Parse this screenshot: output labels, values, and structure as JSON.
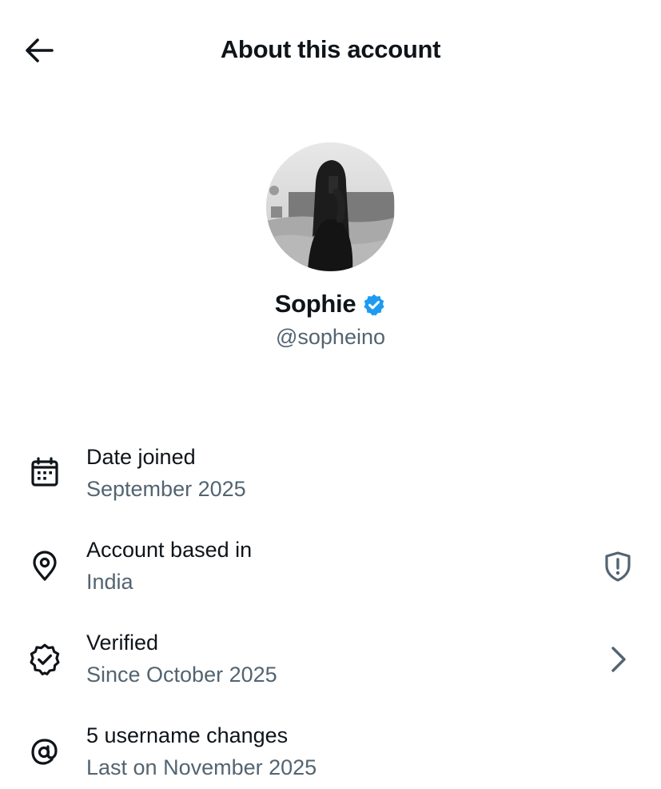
{
  "header": {
    "title": "About this account",
    "back_icon": "arrow-left-icon"
  },
  "profile": {
    "name": "Sophie",
    "handle": "@sopheino",
    "verified": true,
    "verified_color": "#1d9bf0"
  },
  "details": [
    {
      "icon": "calendar-icon",
      "title": "Date joined",
      "subtitle": "September 2025"
    },
    {
      "icon": "location-pin-icon",
      "title": "Account based in",
      "subtitle": "India",
      "trailing_icon": "shield-alert-icon"
    },
    {
      "icon": "verified-check-icon",
      "title": "Verified",
      "subtitle": "Since October 2025",
      "trailing_icon": "chevron-right-icon"
    },
    {
      "icon": "at-sign-icon",
      "title": "5 username changes",
      "subtitle": "Last on November 2025"
    }
  ],
  "colors": {
    "text_primary": "#0f1419",
    "text_secondary": "#536471",
    "accent": "#1d9bf0"
  }
}
